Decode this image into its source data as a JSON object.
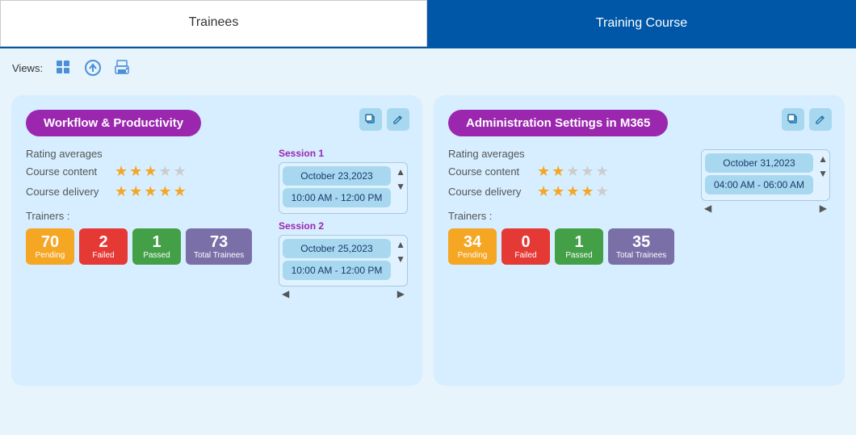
{
  "tabs": [
    {
      "id": "trainees",
      "label": "Trainees",
      "active": false
    },
    {
      "id": "training-course",
      "label": "Training Course",
      "active": true
    }
  ],
  "views": {
    "label": "Views:",
    "icons": [
      "grid-icon",
      "upload-icon",
      "print-icon"
    ]
  },
  "cards": [
    {
      "id": "card-1",
      "title": "Workflow & Productivity",
      "rating": {
        "label": "Rating averages",
        "course_content_label": "Course content",
        "course_content_stars": 3,
        "course_delivery_label": "Course delivery",
        "course_delivery_stars": 5
      },
      "trainers_label": "Trainers :",
      "badges": [
        {
          "num": "70",
          "label": "Pending",
          "color": "yellow"
        },
        {
          "num": "2",
          "label": "Failed",
          "color": "red"
        },
        {
          "num": "1",
          "label": "Passed",
          "color": "green"
        },
        {
          "num": "73",
          "label": "Total Trainees",
          "color": "purple"
        }
      ],
      "sessions": [
        {
          "label": "Session 1",
          "date": "October 23,2023",
          "time": "10:00 AM - 12:00 PM"
        },
        {
          "label": "Session 2",
          "date": "October 25,2023",
          "time": "10:00 AM - 12:00 PM"
        }
      ]
    },
    {
      "id": "card-2",
      "title": "Administration Settings in M365",
      "rating": {
        "label": "Rating averages",
        "course_content_label": "Course content",
        "course_content_stars": 2,
        "course_delivery_label": "Course delivery",
        "course_delivery_stars": 4
      },
      "trainers_label": "Trainers :",
      "badges": [
        {
          "num": "34",
          "label": "Pending",
          "color": "yellow"
        },
        {
          "num": "0",
          "label": "Failed",
          "color": "red"
        },
        {
          "num": "1",
          "label": "Passed",
          "color": "green"
        },
        {
          "num": "35",
          "label": "Total Trainees",
          "color": "purple"
        }
      ],
      "sessions": [
        {
          "label": "",
          "date": "October 31,2023",
          "time": "04:00 AM - 06:00 AM"
        }
      ]
    }
  ]
}
